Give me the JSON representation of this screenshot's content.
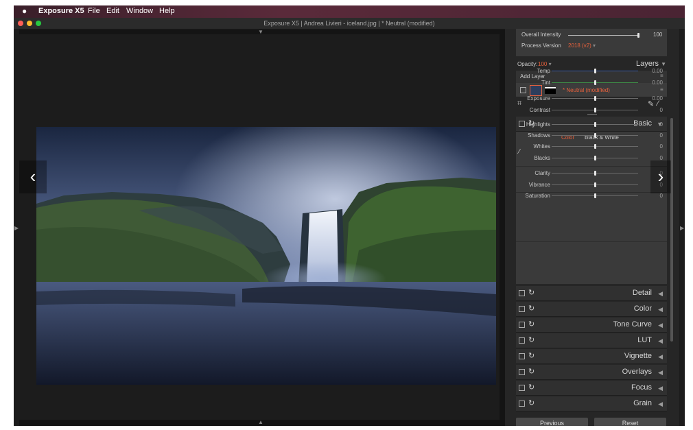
{
  "menubar": {
    "apple": "",
    "app_name": "Exposure X5",
    "items": [
      "File",
      "Edit",
      "Window",
      "Help"
    ]
  },
  "window": {
    "title": "Exposure X5 | Andrea Livieri - iceland.jpg | * Neutral (modified)"
  },
  "colors": {
    "accent": "#e8613c",
    "close": "#fc5f57",
    "minimize": "#fdbc2e",
    "zoom": "#28c840"
  },
  "icons": {
    "prev": "chevron-left-icon",
    "next": "chevron-right-icon"
  },
  "top_panel": {
    "overall_intensity_label": "Overall Intensity",
    "overall_intensity_value": "100",
    "overall_intensity_level": 1.0,
    "process_version_label": "Process Version",
    "process_version_value": "2018 (v2)",
    "opacity_label": "Opacity:",
    "opacity_value": "100",
    "layers_label": "Layers",
    "add_layer_label": "Add Layer",
    "layer_name": "* Neutral (modified)"
  },
  "basic": {
    "title": "Basic",
    "tabs": {
      "color": "Color",
      "bw": "Black & White"
    },
    "sliders": [
      {
        "label": "Temp",
        "value": "0.00",
        "level": 0.5
      },
      {
        "label": "Tint",
        "value": "0.00",
        "level": 0.5
      },
      {
        "label": "Exposure",
        "value": "0.00",
        "level": 0.5
      },
      {
        "label": "Contrast",
        "value": "0",
        "level": 0.5
      },
      {
        "label": "Highlights",
        "value": "0",
        "level": 0.5
      },
      {
        "label": "Shadows",
        "value": "0",
        "level": 0.5
      },
      {
        "label": "Whites",
        "value": "0",
        "level": 0.5
      },
      {
        "label": "Blacks",
        "value": "0",
        "level": 0.5
      },
      {
        "label": "Clarity",
        "value": "0",
        "level": 0.5
      },
      {
        "label": "Vibrance",
        "value": "0",
        "level": 0.5
      },
      {
        "label": "Saturation",
        "value": "0",
        "level": 0.5
      }
    ]
  },
  "sections": [
    "Detail",
    "Color",
    "Tone Curve",
    "LUT",
    "Vignette",
    "Overlays",
    "Focus",
    "Grain"
  ],
  "footer": {
    "previous_label": "Previous",
    "reset_label": "Reset"
  }
}
